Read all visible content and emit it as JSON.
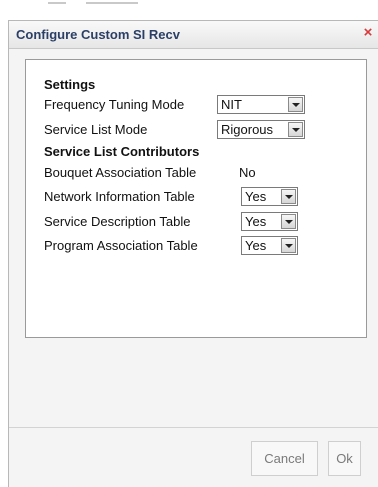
{
  "dialog": {
    "title": "Configure Custom SI Recv",
    "close_glyph": "×"
  },
  "settings": {
    "heading": "Settings",
    "frequency_tuning_mode": {
      "label": "Frequency Tuning Mode",
      "value": "NIT"
    },
    "service_list_mode": {
      "label": "Service List Mode",
      "value": "Rigorous"
    }
  },
  "contributors": {
    "heading": "Service List Contributors",
    "bouquet_association_table": {
      "label": "Bouquet Association Table",
      "value": "No"
    },
    "network_information_table": {
      "label": "Network Information Table",
      "value": "Yes"
    },
    "service_description_table": {
      "label": "Service Description Table",
      "value": "Yes"
    },
    "program_association_table": {
      "label": "Program Association Table",
      "value": "Yes"
    }
  },
  "footer": {
    "cancel_label": "Cancel",
    "ok_label": "Ok"
  },
  "colors": {
    "title_text": "#2b3f66",
    "close_icon": "#d93a3a",
    "button_text": "#7a7a7a"
  },
  "icons": {
    "close": "close-icon",
    "dropdown": "chevron-down-icon"
  }
}
